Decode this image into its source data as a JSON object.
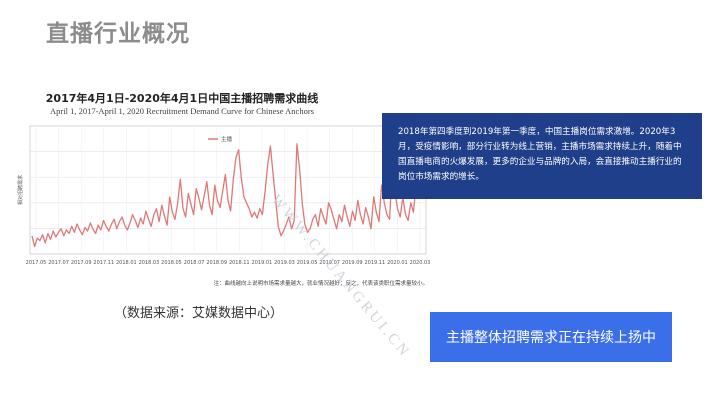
{
  "page": {
    "title": "直播行业概况"
  },
  "source_note": "（数据来源：艾媒数据中心）",
  "info_text": "2018年第四季度到2019年第一季度，中国主播岗位需求激增。2020年3月，受疫情影响，部分行业转为线上营销，主播市场需求持续上升，随着中国直播电商的火爆发展，更多的企业与品牌的入局，会直接推动主播行业的岗位市场需求的增长。",
  "cta_text": "主播整体招聘需求正在持续上扬中",
  "watermark": "WWW.CHUANGRUI.CN",
  "colors": {
    "line": "#e07878",
    "info_bg": "#1f3f8a",
    "cta_bg": "#3b6fea",
    "title": "#8c8c8c"
  },
  "chart_data": {
    "type": "line",
    "title": "2017年4月1日-2020年4月1日中国主播招聘需求曲线",
    "subtitle": "April 1, 2017-April 1, 2020 Recruitment Demand Curve for Chinese Anchors",
    "ylabel": "相对招聘需求",
    "legend": "主播",
    "legend_placement": "top-left",
    "grid": true,
    "footnote": "注：曲线越向上说明市场需求量越大，就业情况越好；反之，代表该类职位需求量较小。",
    "x_ticks": [
      "2017.05",
      "2017.07",
      "2017.09",
      "2017.11",
      "2018.01",
      "2018.03",
      "2018.05",
      "2018.07",
      "2018.09",
      "2018.11",
      "2019.01",
      "2019.03",
      "2019.05",
      "2019.07",
      "2019.09",
      "2019.11",
      "2020.01",
      "2020.03"
    ],
    "y_range": [
      0,
      100
    ],
    "series": [
      {
        "name": "主播",
        "values": [
          12,
          3,
          10,
          8,
          13,
          6,
          14,
          9,
          16,
          11,
          15,
          18,
          12,
          17,
          14,
          20,
          15,
          22,
          17,
          13,
          19,
          16,
          23,
          18,
          14,
          21,
          17,
          25,
          20,
          16,
          22,
          26,
          18,
          24,
          28,
          21,
          17,
          23,
          30,
          25,
          19,
          27,
          22,
          33,
          26,
          20,
          30,
          35,
          24,
          38,
          29,
          21,
          45,
          32,
          26,
          40,
          60,
          35,
          28,
          48,
          39,
          30,
          52,
          44,
          34,
          46,
          58,
          38,
          30,
          55,
          42,
          36,
          50,
          64,
          42,
          33,
          60,
          78,
          85,
          62,
          45,
          40,
          35,
          28,
          32,
          27,
          35,
          30,
          50,
          72,
          88,
          65,
          42,
          20,
          12,
          16,
          22,
          28,
          18,
          25,
          90,
          70,
          40,
          22,
          15,
          18,
          26,
          30,
          20,
          35,
          28,
          22,
          40,
          34,
          26,
          18,
          30,
          24,
          38,
          28,
          20,
          33,
          25,
          42,
          30,
          22,
          36,
          28,
          18,
          45,
          32,
          24,
          55,
          40,
          30,
          26,
          70,
          50,
          35,
          28,
          45,
          30,
          25,
          40,
          32,
          55,
          60,
          75,
          92
        ]
      }
    ]
  }
}
